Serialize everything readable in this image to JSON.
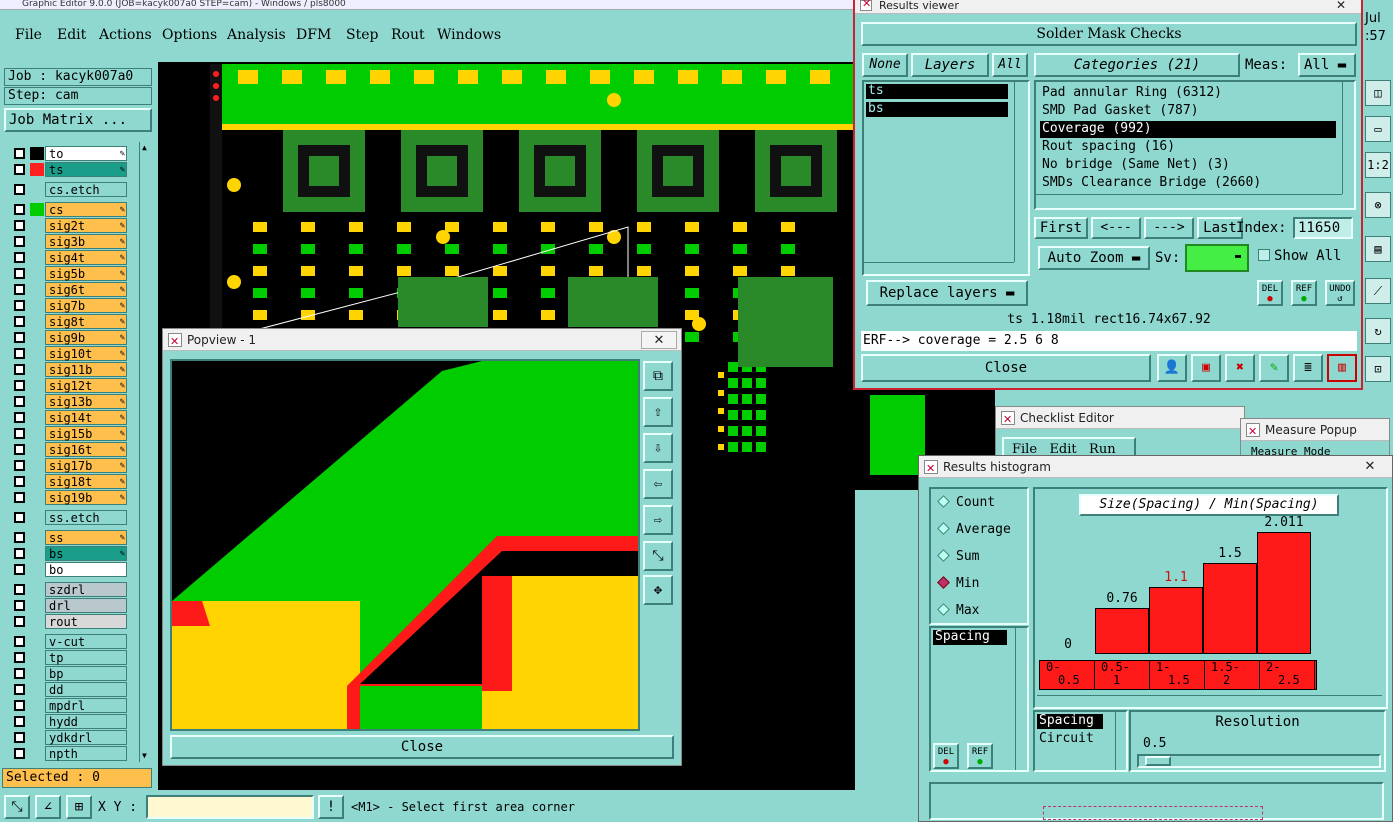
{
  "main_window": {
    "title": "Graphic Editor 9.0.0 (JOB=kacyk007a0 STEP=cam) - Windows / pls8000",
    "menu": [
      "File",
      "Edit",
      "Actions",
      "Options",
      "Analysis",
      "DFM",
      "Step",
      "Rout",
      "Windows"
    ]
  },
  "left_panel": {
    "job": "Job : kacyk007a0",
    "step": "Step: cam",
    "job_matrix": "Job Matrix ...",
    "layers": [
      {
        "name": "to",
        "color": "#ffffff",
        "dot": "#000000"
      },
      {
        "name": "ts",
        "color": "#1a9e8a",
        "dot": "#ff2020"
      },
      {
        "name": "cs.etch",
        "color": "#8fd8d0",
        "dot": ""
      },
      {
        "name": "cs",
        "color": "#ffbf4d",
        "dot": "#00cc00"
      },
      {
        "name": "sig2t",
        "color": "#ffbf4d",
        "dot": ""
      },
      {
        "name": "sig3b",
        "color": "#ffbf4d",
        "dot": ""
      },
      {
        "name": "sig4t",
        "color": "#ffbf4d",
        "dot": ""
      },
      {
        "name": "sig5b",
        "color": "#ffbf4d",
        "dot": ""
      },
      {
        "name": "sig6t",
        "color": "#ffbf4d",
        "dot": ""
      },
      {
        "name": "sig7b",
        "color": "#ffbf4d",
        "dot": ""
      },
      {
        "name": "sig8t",
        "color": "#ffbf4d",
        "dot": ""
      },
      {
        "name": "sig9b",
        "color": "#ffbf4d",
        "dot": ""
      },
      {
        "name": "sig10t",
        "color": "#ffbf4d",
        "dot": ""
      },
      {
        "name": "sig11b",
        "color": "#ffbf4d",
        "dot": ""
      },
      {
        "name": "sig12t",
        "color": "#ffbf4d",
        "dot": ""
      },
      {
        "name": "sig13b",
        "color": "#ffbf4d",
        "dot": ""
      },
      {
        "name": "sig14t",
        "color": "#ffbf4d",
        "dot": ""
      },
      {
        "name": "sig15b",
        "color": "#ffbf4d",
        "dot": ""
      },
      {
        "name": "sig16t",
        "color": "#ffbf4d",
        "dot": ""
      },
      {
        "name": "sig17b",
        "color": "#ffbf4d",
        "dot": ""
      },
      {
        "name": "sig18t",
        "color": "#ffbf4d",
        "dot": ""
      },
      {
        "name": "sig19b",
        "color": "#ffbf4d",
        "dot": ""
      },
      {
        "name": "ss.etch",
        "color": "#8fd8d0",
        "dot": ""
      },
      {
        "name": "ss",
        "color": "#ffbf4d",
        "dot": ""
      },
      {
        "name": "bs",
        "color": "#1a9e8a",
        "dot": ""
      },
      {
        "name": "bo",
        "color": "#ffffff",
        "dot": ""
      },
      {
        "name": "szdrl",
        "color": "#b8c8cc",
        "dot": ""
      },
      {
        "name": "drl",
        "color": "#b8c8cc",
        "dot": ""
      },
      {
        "name": "rout",
        "color": "#d8d8d8",
        "dot": ""
      },
      {
        "name": "v-cut",
        "color": "#8fd8d0",
        "dot": ""
      },
      {
        "name": "tp",
        "color": "#8fd8d0",
        "dot": ""
      },
      {
        "name": "bp",
        "color": "#8fd8d0",
        "dot": ""
      },
      {
        "name": "dd",
        "color": "#8fd8d0",
        "dot": ""
      },
      {
        "name": "mpdrl",
        "color": "#8fd8d0",
        "dot": ""
      },
      {
        "name": "hydd",
        "color": "#8fd8d0",
        "dot": ""
      },
      {
        "name": "ydkdrl",
        "color": "#8fd8d0",
        "dot": ""
      },
      {
        "name": "npth",
        "color": "#8fd8d0",
        "dot": ""
      }
    ],
    "selected": "Selected : 0"
  },
  "status_bar": {
    "xy_label": "X Y :",
    "xy_value": "",
    "prompt": "<M1> - Select first area corner"
  },
  "results_viewer": {
    "title": "Results viewer",
    "header": "Solder Mask Checks",
    "btn_none": "None",
    "btn_layers": "Layers",
    "btn_all": "All",
    "layers": [
      "ts",
      "bs"
    ],
    "categories_label": "Categories (21)",
    "meas_label": "Meas:",
    "meas_value": "All",
    "categories": [
      "Pad annular Ring (6312)",
      "SMD Pad Gasket (787)",
      "Coverage (992)",
      "Rout spacing (16)",
      "No bridge (Same Net) (3)",
      "SMDs Clearance Bridge (2660)"
    ],
    "selected_category": 2,
    "first": "First",
    "prev": "<---",
    "next": "--->",
    "last": "Last",
    "index_label": "Index:",
    "index_value": "11650",
    "auto_zoom": "Auto Zoom",
    "sv_label": "Sv:",
    "show_all": "Show All",
    "replace_layers": "Replace layers",
    "del": "DEL",
    "ref": "REF",
    "undo": "UNDO",
    "info_line": "ts 1.18mil   rect16.74x67.92",
    "erf_line": "ERF--> coverage = 2.5 6 8",
    "close": "Close"
  },
  "popview": {
    "title": "Popview - 1",
    "close": "Close"
  },
  "checklist_editor": {
    "title": "Checklist Editor",
    "menu": [
      "File",
      "Edit",
      "Run"
    ]
  },
  "measure_popup": {
    "title": "Measure Popup",
    "sub": "Measure Mode"
  },
  "histogram": {
    "title": "Results histogram",
    "modes": [
      "Count",
      "Average",
      "Sum",
      "Min",
      "Max"
    ],
    "selected_mode": 3,
    "list": [
      "Spacing"
    ],
    "list2": [
      "Spacing",
      "Circuit"
    ],
    "resolution_label": "Resolution",
    "resolution_value": "0.5",
    "del": "DEL",
    "ref": "REF",
    "chart_data": {
      "type": "bar",
      "title": "Size(Spacing) / Min(Spacing)",
      "categories": [
        "0-\n0.5",
        "0.5-\n1",
        "1-\n1.5",
        "1.5-\n2",
        "2-\n2.5"
      ],
      "category_labels": [
        [
          "0-",
          "0.5"
        ],
        [
          "0.5-",
          "1"
        ],
        [
          "1-",
          "1.5"
        ],
        [
          "1.5-",
          "2"
        ],
        [
          "2-",
          "2.5"
        ]
      ],
      "values": [
        0,
        0.76,
        1.1,
        1.5,
        2.011
      ],
      "value_labels": [
        "0",
        "0.76",
        "1.1",
        "1.5",
        "2.011"
      ],
      "highlight_index": 2,
      "bar_color": "#ff1a1a",
      "highlight_label_color": "#d01010",
      "ylim": [
        0,
        2.2
      ]
    }
  },
  "clock": {
    "line1": "Jul",
    "line2": ":57"
  },
  "colors": {
    "panel": "#8fd8d0",
    "green": "#00cc00",
    "yellow": "#ffd400",
    "red": "#ff1a1a"
  }
}
